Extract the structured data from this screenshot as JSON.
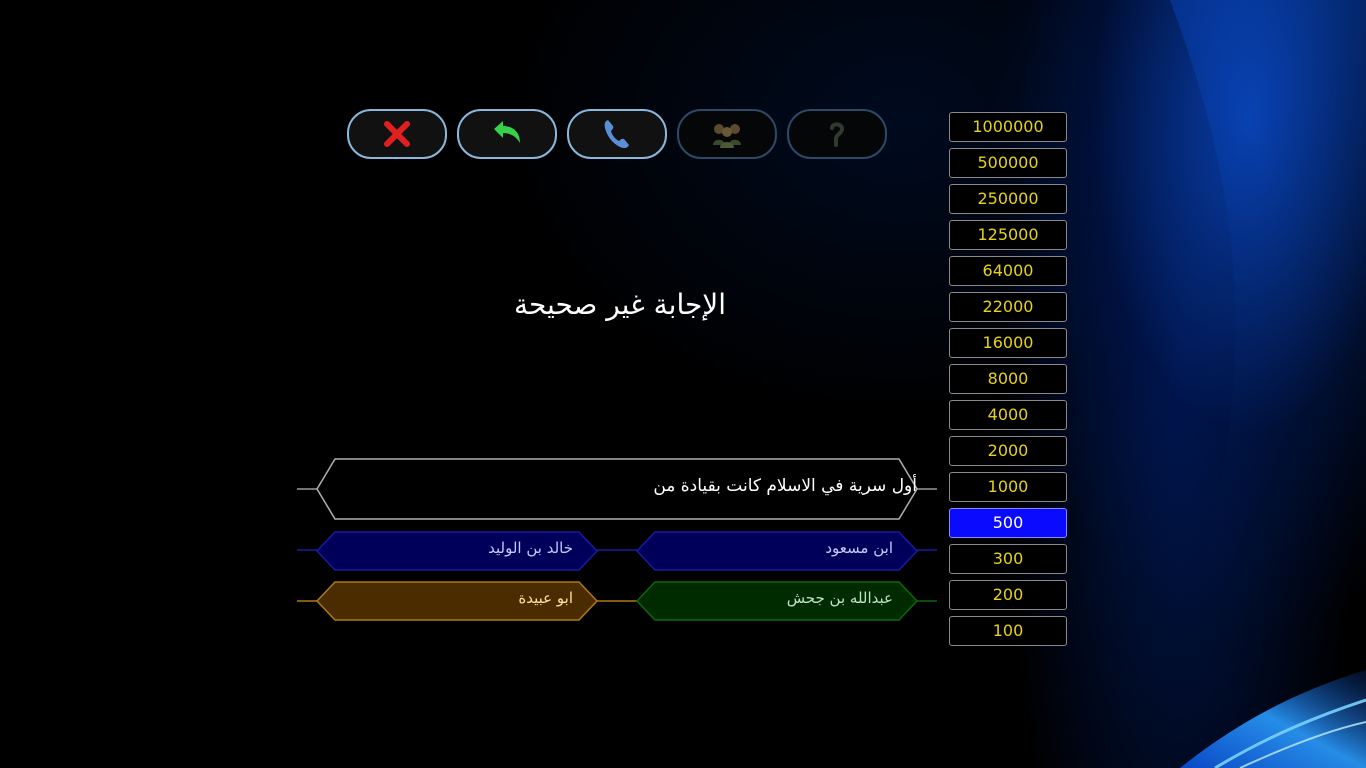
{
  "lifelines": [
    {
      "name": "exit-icon",
      "state": "active",
      "color": "#e02020"
    },
    {
      "name": "undo-arrow-icon",
      "state": "active",
      "color": "#35d14a"
    },
    {
      "name": "phone-icon",
      "state": "active",
      "color": "#5a8fd6"
    },
    {
      "name": "audience-icon",
      "state": "used",
      "color": "#5c4a30"
    },
    {
      "name": "question-mark-icon",
      "state": "used",
      "color": "#2e3b2e"
    }
  ],
  "ladder": {
    "amounts": [
      "1000000",
      "500000",
      "250000",
      "125000",
      "64000",
      "22000",
      "16000",
      "8000",
      "4000",
      "2000",
      "1000",
      "500",
      "300",
      "200",
      "100"
    ],
    "current": "500",
    "text_color": "#e6d21a",
    "highlight_color": "#0a0aff"
  },
  "message": "الإجابة غير صحيحة",
  "question": "أول سرية في الاسلام كانت بقيادة من",
  "answers": {
    "top_right": {
      "text": "ابن مسعود",
      "fill": "#00005a",
      "stroke": "#1a1aa0",
      "text_color": "#c8c8ff"
    },
    "top_left": {
      "text": "خالد بن الوليد",
      "fill": "#00005a",
      "stroke": "#1a1aa0",
      "text_color": "#c8c8ff"
    },
    "bottom_right": {
      "text": "عبدالله بن جحش",
      "fill": "#002a00",
      "stroke": "#0a6a0a",
      "text_color": "#b8e8b8"
    },
    "bottom_left": {
      "text": "ابو عبيدة",
      "fill": "#4a2c00",
      "stroke": "#b07818",
      "text_color": "#ffe0a0"
    }
  }
}
